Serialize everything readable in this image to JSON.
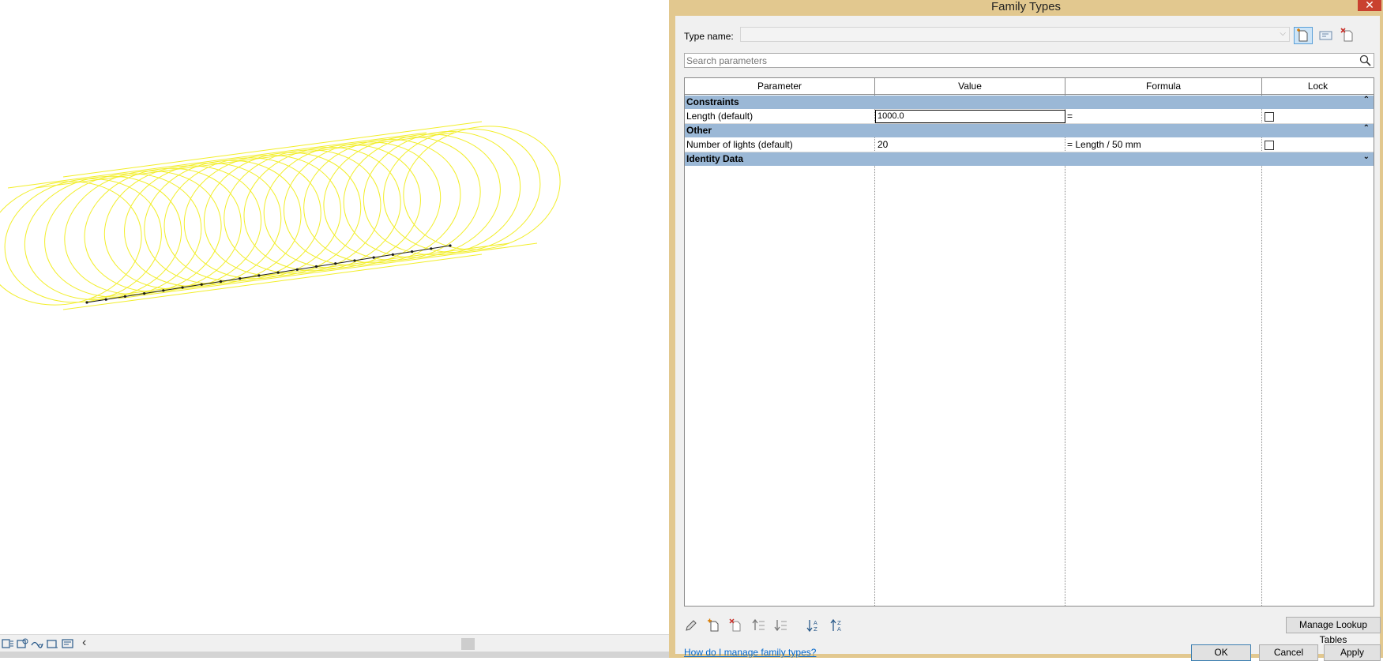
{
  "dialog": {
    "title": "Family Types",
    "close_glyph": "✕",
    "type_name_label": "Type name:",
    "type_name_value": "",
    "search_placeholder": "Search parameters",
    "columns": [
      "Parameter",
      "Value",
      "Formula",
      "Lock"
    ],
    "groups": [
      {
        "label": "Constraints",
        "expanded": true,
        "toggle_icon": "⌃",
        "params": [
          {
            "name": "Length (default)",
            "value": "1000.0",
            "formula": "=",
            "locked": false,
            "editing": true
          }
        ]
      },
      {
        "label": "Other",
        "expanded": true,
        "toggle_icon": "⌃",
        "params": [
          {
            "name": "Number of lights (default)",
            "value": "20",
            "formula": "= Length / 50 mm",
            "locked": false,
            "editing": false
          }
        ]
      },
      {
        "label": "Identity Data",
        "expanded": false,
        "toggle_icon": "⌄",
        "params": []
      }
    ],
    "toolbar_icons": [
      "edit-parameter-icon",
      "new-parameter-icon",
      "delete-parameter-icon",
      "move-up-icon",
      "move-down-icon",
      "sort-ascending-icon",
      "sort-descending-icon"
    ],
    "manage_lookup_label": "Manage Lookup Tables",
    "help_link": "How do I manage family types?",
    "ok_label": "OK",
    "cancel_label": "Cancel",
    "apply_label": "Apply"
  },
  "viewport": {
    "nav_arrow": "‹",
    "model_color": "#f2ee2a",
    "spline_color": "#1a1a1a"
  },
  "colors": {
    "window_frame": "#e2c88f",
    "group_header": "#9bb8d6",
    "close_button": "#c9412f",
    "link": "#0066cc"
  }
}
